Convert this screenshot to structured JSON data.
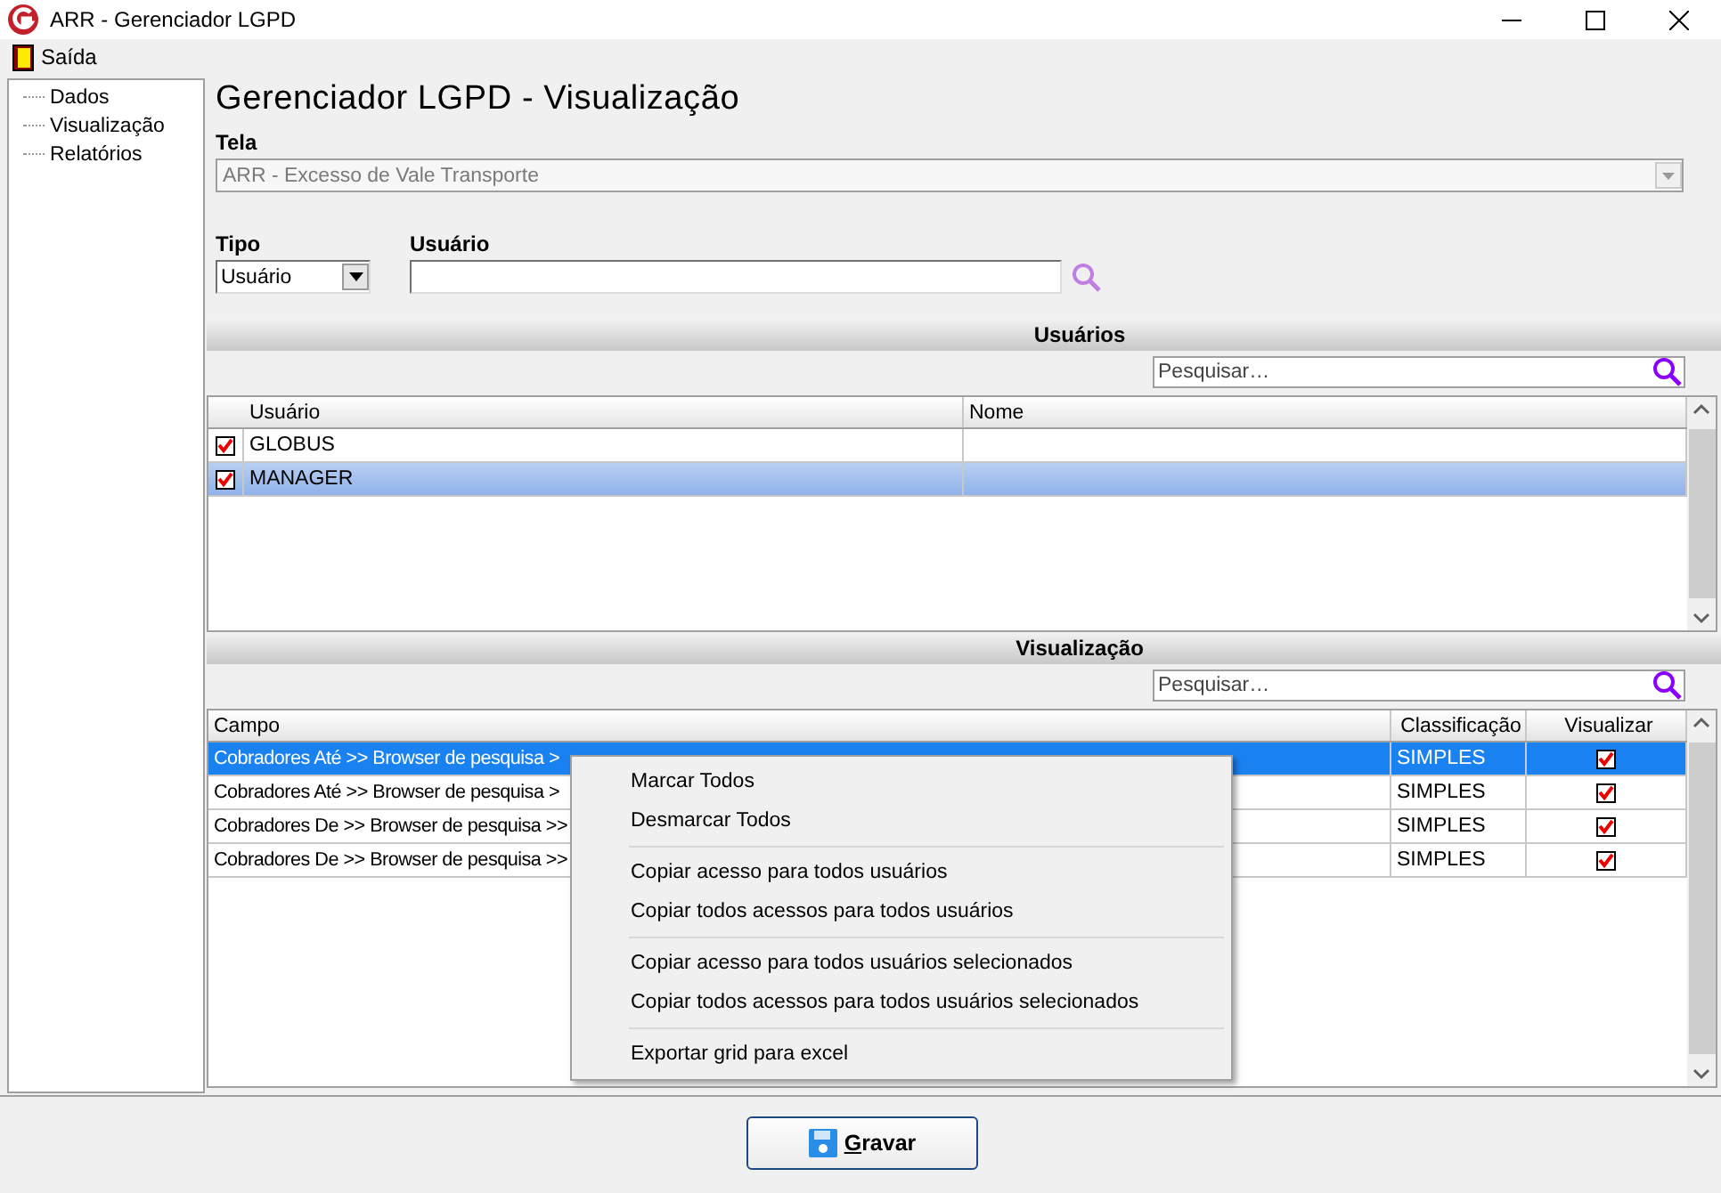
{
  "window": {
    "title": "ARR - Gerenciador LGPD"
  },
  "menu_bar": [
    {
      "label": "Saída"
    }
  ],
  "sidebar": {
    "items": [
      {
        "label": "Dados"
      },
      {
        "label": "Visualização"
      },
      {
        "label": "Relatórios"
      }
    ]
  },
  "heading": "Gerenciador LGPD - Visualização",
  "tela": {
    "label": "Tela",
    "value": "ARR - Excesso de Vale Transporte",
    "disabled": true
  },
  "tipo": {
    "label": "Tipo",
    "value": "Usuário"
  },
  "usuario": {
    "label": "Usuário"
  },
  "usuarios_section": {
    "title": "Usuários",
    "search": {
      "placeholder": "Pesquisar…"
    },
    "columns": [
      "Usuário",
      "Nome"
    ],
    "rows": [
      {
        "checked": true,
        "usuario": "GLOBUS",
        "selected": false
      },
      {
        "checked": true,
        "usuario": "MANAGER",
        "selected": true
      }
    ]
  },
  "visualizacao_section": {
    "title": "Visualização",
    "search": {
      "placeholder": "Pesquisar…"
    },
    "columns": [
      "Campo",
      "Classificação",
      "Visualizar"
    ],
    "rows": [
      {
        "campo": "Cobradores Até >> Browser de pesquisa >",
        "classificacao": "SIMPLES",
        "visualizar": true,
        "selected": true
      },
      {
        "campo": "Cobradores Até >> Browser de pesquisa >",
        "classificacao": "SIMPLES",
        "visualizar": true,
        "selected": false
      },
      {
        "campo": "Cobradores De >> Browser de pesquisa >>",
        "classificacao": "SIMPLES",
        "visualizar": true,
        "selected": false
      },
      {
        "campo": "Cobradores De >> Browser de pesquisa >>",
        "classificacao": "SIMPLES",
        "visualizar": true,
        "selected": false
      }
    ]
  },
  "context_menu": {
    "groups": [
      [
        "Marcar Todos",
        "Desmarcar Todos"
      ],
      [
        "Copiar acesso para todos usuários",
        "Copiar todos acessos para todos usuários"
      ],
      [
        "Copiar acesso para todos usuários selecionados",
        "Copiar todos acessos para todos usuários selecionados"
      ],
      [
        "Exportar grid para excel"
      ]
    ]
  },
  "save_button": {
    "label": "Gravar"
  }
}
